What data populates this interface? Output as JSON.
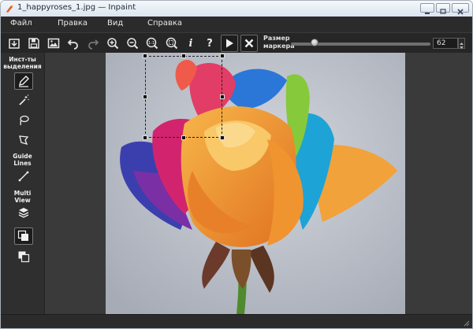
{
  "window": {
    "title": "1_happyroses_1.jpg — Inpaint"
  },
  "menu": {
    "items": [
      "Файл",
      "Правка",
      "Вид",
      "Справка"
    ]
  },
  "toolbar": {
    "buttons": [
      "open-icon",
      "save-icon",
      "save-as-icon",
      "undo-icon",
      "redo-icon",
      "zoom-in-icon",
      "zoom-out-icon",
      "zoom-actual-icon",
      "zoom-fit-icon",
      "info-icon",
      "help-icon",
      "run-icon",
      "cancel-icon"
    ],
    "info_glyph": "i",
    "help_glyph": "?",
    "marker_label": "Размер\nмаркера",
    "marker_value": "62",
    "marker_slider_fraction": 0.15
  },
  "sidebar": {
    "selection_title": "Инст-ты\nвыделения",
    "guide_title": "Guide\nLines",
    "multiview_title": "Multi\nView",
    "tools": [
      "marker-icon",
      "magic-wand-icon",
      "lasso-icon",
      "polygonal-lasso-icon",
      "guide-line-icon",
      "layers-icon",
      "multiview-mode-1-icon",
      "multiview-mode-2-icon"
    ]
  },
  "colors": {
    "app_background": "#2f2f2f",
    "toolbar_background": "#262626",
    "photo_background": "#b9bdc6",
    "accent_text": "#f0f0f0"
  }
}
